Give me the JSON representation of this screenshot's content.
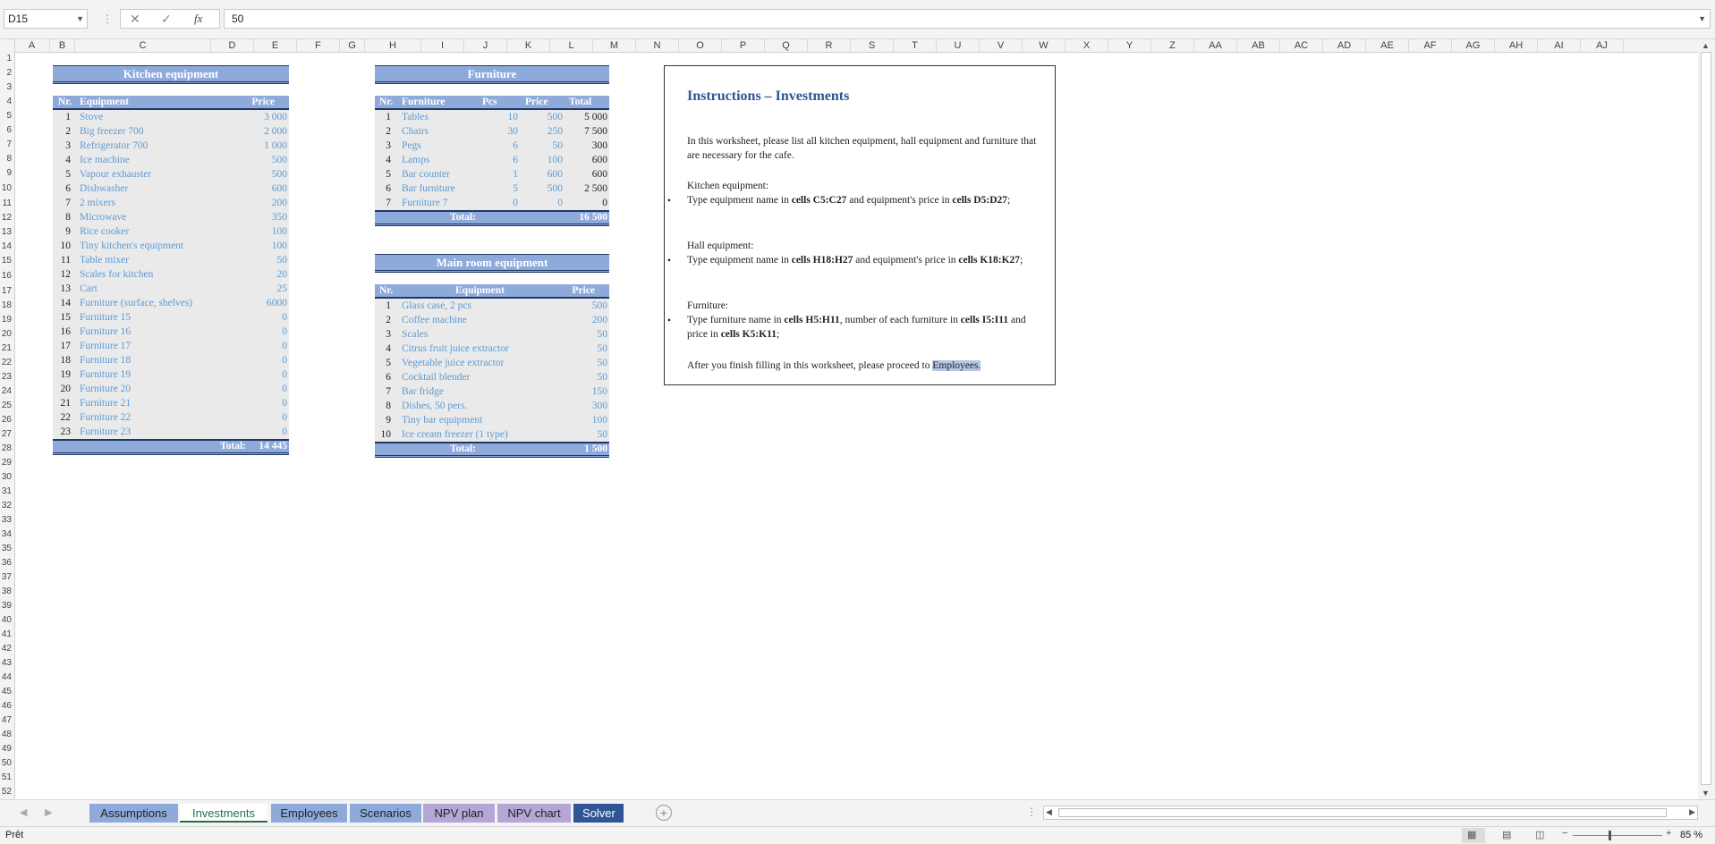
{
  "formula_bar": {
    "name_box": "D15",
    "fx": "fx",
    "value": "50"
  },
  "columns": [
    "A",
    "B",
    "C",
    "D",
    "E",
    "F",
    "G",
    "H",
    "I",
    "J",
    "K",
    "L",
    "M",
    "N",
    "O",
    "P",
    "Q",
    "R",
    "S",
    "T",
    "U",
    "V",
    "W",
    "X",
    "Y",
    "Z",
    "AA",
    "AB",
    "AC",
    "AD",
    "AE",
    "AF",
    "AG",
    "AH",
    "AI",
    "AJ"
  ],
  "kitchen": {
    "title": "Kitchen equipment",
    "headers": {
      "nr": "Nr.",
      "equipment": "Equipment",
      "price": "Price"
    },
    "rows": [
      {
        "nr": "1",
        "name": "Stove",
        "price": "3 000"
      },
      {
        "nr": "2",
        "name": "Big freezer 700",
        "price": "2 000"
      },
      {
        "nr": "3",
        "name": "Refrigerator 700",
        "price": "1 000"
      },
      {
        "nr": "4",
        "name": "Ice machine",
        "price": "500"
      },
      {
        "nr": "5",
        "name": "Vapour exhauster",
        "price": "500"
      },
      {
        "nr": "6",
        "name": "Dishwasher",
        "price": "600"
      },
      {
        "nr": "7",
        "name": "2 mixers",
        "price": "200"
      },
      {
        "nr": "8",
        "name": "Microwave",
        "price": "350"
      },
      {
        "nr": "9",
        "name": "Rice cooker",
        "price": "100"
      },
      {
        "nr": "10",
        "name": "Tiny kitchen's equipment",
        "price": "100"
      },
      {
        "nr": "11",
        "name": "Table mixer",
        "price": "50"
      },
      {
        "nr": "12",
        "name": "Scales for kitchen",
        "price": "20"
      },
      {
        "nr": "13",
        "name": "Cart",
        "price": "25"
      },
      {
        "nr": "14",
        "name": "Furniture (surface, shelves)",
        "price": "6000"
      },
      {
        "nr": "15",
        "name": "Furniture 15",
        "price": "0"
      },
      {
        "nr": "16",
        "name": "Furniture 16",
        "price": "0"
      },
      {
        "nr": "17",
        "name": "Furniture 17",
        "price": "0"
      },
      {
        "nr": "18",
        "name": "Furniture 18",
        "price": "0"
      },
      {
        "nr": "19",
        "name": "Furniture 19",
        "price": "0"
      },
      {
        "nr": "20",
        "name": "Furniture 20",
        "price": "0"
      },
      {
        "nr": "21",
        "name": "Furniture 21",
        "price": "0"
      },
      {
        "nr": "22",
        "name": "Furniture 22",
        "price": "0"
      },
      {
        "nr": "23",
        "name": "Furniture 23",
        "price": "0"
      }
    ],
    "total_label": "Total:",
    "total_value": "14 445"
  },
  "furniture": {
    "title": "Furniture",
    "headers": {
      "nr": "Nr.",
      "furniture": "Furniture",
      "pcs": "Pcs",
      "price": "Price",
      "total": "Total"
    },
    "rows": [
      {
        "nr": "1",
        "name": "Tables",
        "pcs": "10",
        "price": "500",
        "total": "5 000"
      },
      {
        "nr": "2",
        "name": "Chairs",
        "pcs": "30",
        "price": "250",
        "total": "7 500"
      },
      {
        "nr": "3",
        "name": "Pegs",
        "pcs": "6",
        "price": "50",
        "total": "300"
      },
      {
        "nr": "4",
        "name": "Lamps",
        "pcs": "6",
        "price": "100",
        "total": "600"
      },
      {
        "nr": "5",
        "name": "Bar counter",
        "pcs": "1",
        "price": "600",
        "total": "600"
      },
      {
        "nr": "6",
        "name": "Bar furniture",
        "pcs": "5",
        "price": "500",
        "total": "2 500"
      },
      {
        "nr": "7",
        "name": "Furniture 7",
        "pcs": "0",
        "price": "0",
        "total": "0"
      }
    ],
    "total_label": "Total:",
    "total_value": "16 500"
  },
  "mainroom": {
    "title": "Main room equipment",
    "headers": {
      "nr": "Nr.",
      "equipment": "Equipment",
      "price": "Price"
    },
    "rows": [
      {
        "nr": "1",
        "name": "Glass case, 2 pcs",
        "price": "500"
      },
      {
        "nr": "2",
        "name": "Coffee machine",
        "price": "200"
      },
      {
        "nr": "3",
        "name": "Scales",
        "price": "50"
      },
      {
        "nr": "4",
        "name": "Citrus fruit juice extractor",
        "price": "50"
      },
      {
        "nr": "5",
        "name": "Vegetable juice extractor",
        "price": "50"
      },
      {
        "nr": "6",
        "name": "Cocktail blender",
        "price": "50"
      },
      {
        "nr": "7",
        "name": "Bar fridge",
        "price": "150"
      },
      {
        "nr": "8",
        "name": "Dishes, 50 pers.",
        "price": "300"
      },
      {
        "nr": "9",
        "name": "Tiny bar equipment",
        "price": "100"
      },
      {
        "nr": "10",
        "name": "Ice cream freezer (1 type)",
        "price": "50"
      }
    ],
    "total_label": "Total:",
    "total_value": "1 500"
  },
  "instructions": {
    "title": "Instructions – Investments",
    "intro": "In this worksheet, please list all kitchen equipment, hall equipment and furniture that are necessary for the cafe.",
    "kitchen_head": "Kitchen equipment:",
    "kitchen_a": "Type equipment name in ",
    "kitchen_b": "cells C5:C27",
    "kitchen_c": " and equipment's price in ",
    "kitchen_d": "cells D5:D27",
    "kitchen_e": ";",
    "hall_head": "Hall equipment:",
    "hall_a": "Type equipment name in ",
    "hall_b": "cells H18:H27",
    "hall_c": " and equipment's price in ",
    "hall_d": "cells K18:K27",
    "hall_e": ";",
    "furn_head": "Furniture:",
    "furn_a": "Type furniture name in ",
    "furn_b": "cells H5:H11",
    "furn_c": ", number of each furniture in ",
    "furn_d": "cells I5:I11",
    "furn_e": " and price in ",
    "furn_f": "cells K5:K11",
    "furn_g": ";",
    "outro_a": "After you finish filling in this worksheet, please proceed to ",
    "outro_link": "Employees."
  },
  "sheet_tabs": [
    {
      "label": "Assumptions",
      "color": "#8eaadb"
    },
    {
      "label": "Investments",
      "color": "#ffffff"
    },
    {
      "label": "Employees",
      "color": "#8eaadb"
    },
    {
      "label": "Scenarios",
      "color": "#8eaadb"
    },
    {
      "label": "NPV plan",
      "color": "#b4a7d6"
    },
    {
      "label": "NPV chart",
      "color": "#b4a7d6"
    },
    {
      "label": "Solver",
      "color": "#2f5597"
    }
  ],
  "status": {
    "ready": "Prêt",
    "zoom": "85 %"
  }
}
